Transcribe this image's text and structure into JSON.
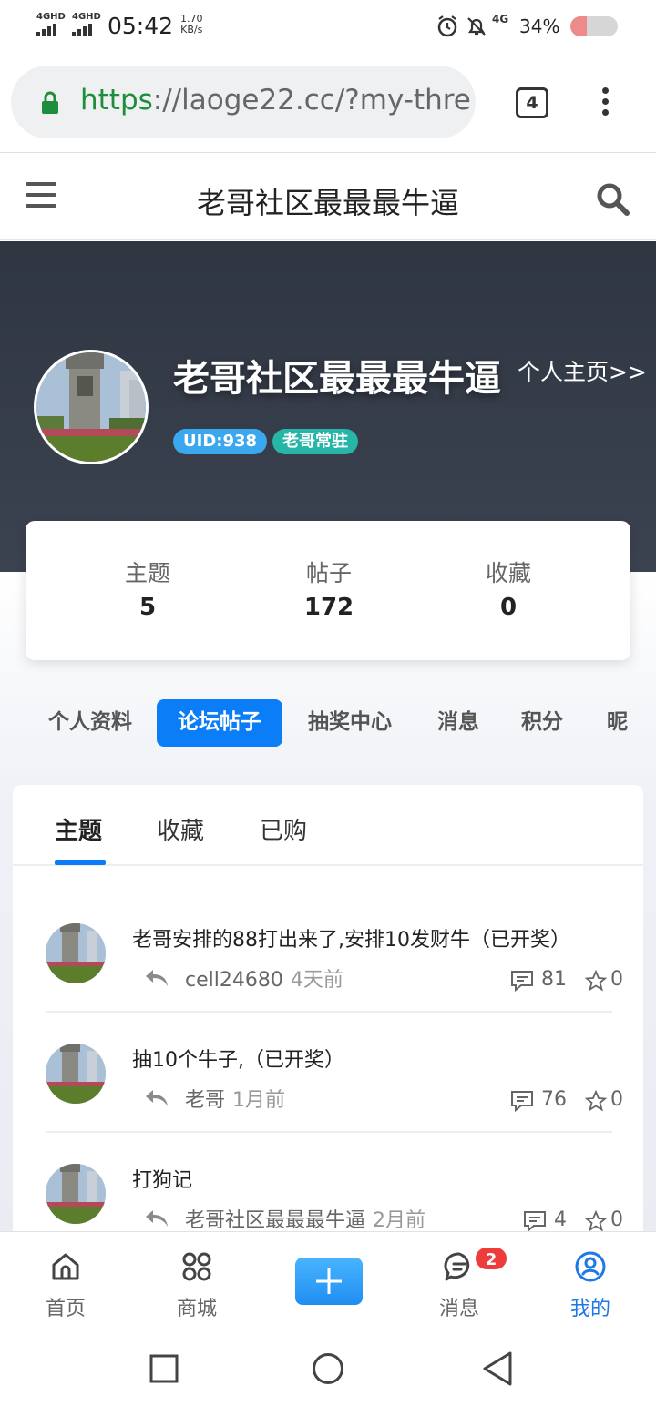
{
  "status_bar": {
    "sim1": "4GHD",
    "sim2": "4GHD",
    "time": "05:42",
    "net_speed_value": "1.70",
    "net_speed_unit": "KB/s",
    "net_type": "4G",
    "battery": "34%",
    "battery_level": 0.34
  },
  "browser": {
    "url_scheme": "https",
    "url_rest": "://laoge22.cc/?my-thre",
    "tab_count": "4"
  },
  "header": {
    "title": "老哥社区最最最牛逼"
  },
  "profile": {
    "name": "老哥社区最最最牛逼",
    "homepage_link": "个人主页>>",
    "uid_badge": "UID:938",
    "rank_badge": "老哥常驻"
  },
  "stats": [
    {
      "label": "主题",
      "value": "5"
    },
    {
      "label": "帖子",
      "value": "172"
    },
    {
      "label": "收藏",
      "value": "0"
    }
  ],
  "profile_tabs": [
    "个人资料",
    "论坛帖子",
    "抽奖中心",
    "消息",
    "积分",
    "昵"
  ],
  "sub_tabs": [
    "主题",
    "收藏",
    "已购"
  ],
  "posts": [
    {
      "title": "老哥安排的88打出来了,安排10发财牛（已开奖）",
      "author": "cell24680",
      "time": "4天前",
      "comments": "81",
      "favorites": "0"
    },
    {
      "title": "抽10个牛子,（已开奖）",
      "author": "老哥",
      "time": "1月前",
      "comments": "76",
      "favorites": "0"
    },
    {
      "title": "打狗记",
      "author": "老哥社区最最最牛逼",
      "time": "2月前",
      "comments": "4",
      "favorites": "0"
    }
  ],
  "bottom_nav": {
    "home": "首页",
    "shop": "商城",
    "messages": "消息",
    "messages_badge": "2",
    "mine": "我的"
  },
  "colors": {
    "accent": "#0a7df7",
    "hero_bg": "#2f3642",
    "uid_badge": "#3aa7ee",
    "rank_badge": "#26b5a7",
    "badge_red": "#ee3b3b"
  },
  "icons": [
    "lock-icon",
    "hamburger-icon",
    "search-icon",
    "reply-icon",
    "comment-icon",
    "star-icon",
    "home-icon",
    "grid-icon",
    "plus-icon",
    "chat-icon",
    "user-circle-icon",
    "recents-icon",
    "home-circle-icon",
    "back-triangle-icon"
  ]
}
